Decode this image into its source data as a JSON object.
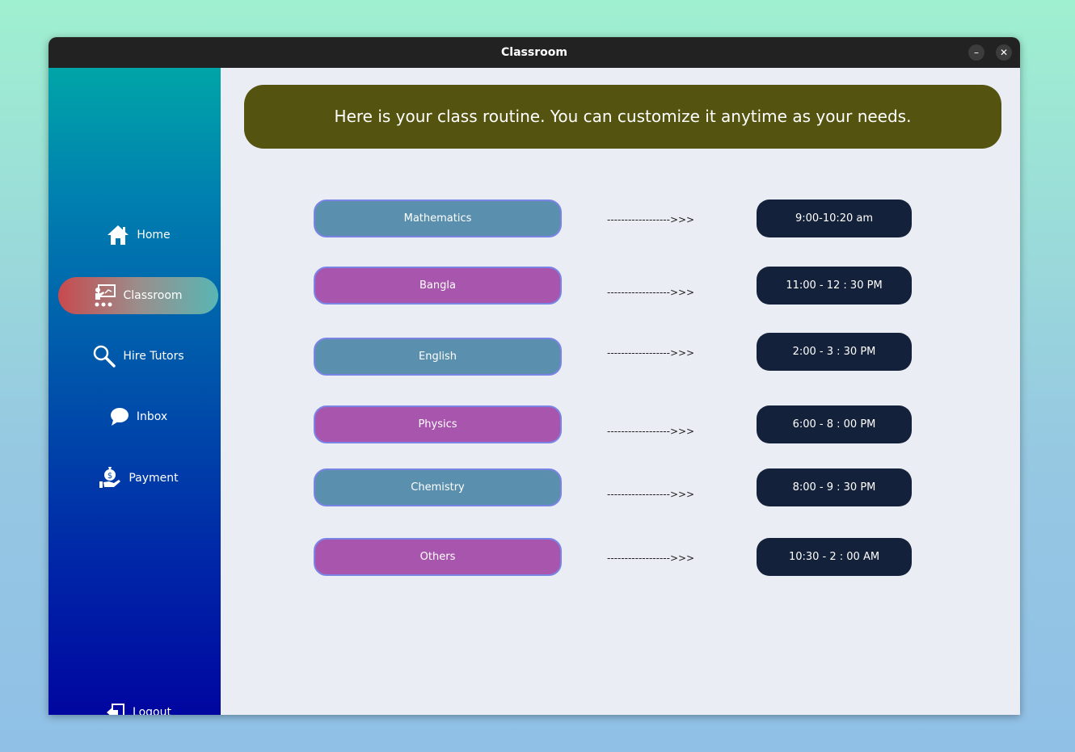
{
  "window": {
    "title": "Classroom",
    "minimize_icon": "minimize-icon",
    "close_icon": "close-icon"
  },
  "sidebar": {
    "items": [
      {
        "label": "Home",
        "icon": "home-icon"
      },
      {
        "label": "Classroom",
        "icon": "classroom-icon",
        "active": true
      },
      {
        "label": "Hire Tutors",
        "icon": "search-icon"
      },
      {
        "label": "Inbox",
        "icon": "chat-bubble-icon"
      },
      {
        "label": "Payment",
        "icon": "money-hand-icon"
      }
    ],
    "logout": {
      "label": "Logout",
      "icon": "logout-icon"
    }
  },
  "main": {
    "banner": "Here is your class routine. You can customize it anytime as your needs.",
    "routine": [
      {
        "subject": "Mathematics",
        "arrow": "------------------>>>",
        "time": "9:00-10:20 am",
        "color": "#5a90ae"
      },
      {
        "subject": "Bangla",
        "arrow": "------------------>>>",
        "time": "11:00 - 12 : 30 PM",
        "color": "#a856ad"
      },
      {
        "subject": "English",
        "arrow": "------------------>>>",
        "time": "2:00 - 3 : 30 PM",
        "color": "#5a90ae"
      },
      {
        "subject": "Physics",
        "arrow": "------------------>>>",
        "time": "6:00 - 8 : 00 PM",
        "color": "#a856ad"
      },
      {
        "subject": "Chemistry",
        "arrow": "------------------>>>",
        "time": "8:00 - 9 : 30 PM",
        "color": "#5a90ae"
      },
      {
        "subject": "Others",
        "arrow": "------------------>>>",
        "time": "10:30 - 2 : 00 AM",
        "color": "#a856ad"
      }
    ]
  },
  "colors": {
    "banner_bg": "#545410",
    "time_bg": "#14213a",
    "subject_blue": "#5a90ae",
    "subject_purple": "#a856ad",
    "subject_border": "#7a84e4",
    "content_bg": "#ebedf4"
  }
}
